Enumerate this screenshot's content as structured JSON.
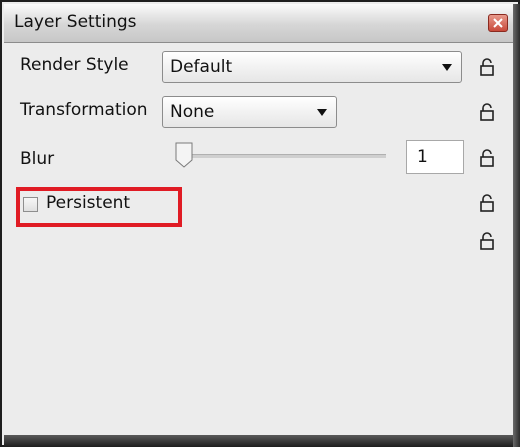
{
  "window": {
    "title": "Layer Settings"
  },
  "fields": {
    "render_style": {
      "label": "Render Style",
      "value": "Default"
    },
    "transformation": {
      "label": "Transformation",
      "value": "None"
    },
    "blur": {
      "label": "Blur",
      "value": "1"
    },
    "persistent": {
      "label": "Persistent",
      "checked": false
    }
  },
  "icons": {
    "close": "close-icon",
    "lock": "unlocked-padlock-icon",
    "dropdown": "chevron-down-icon"
  },
  "colors": {
    "highlight": "#e01b24"
  }
}
